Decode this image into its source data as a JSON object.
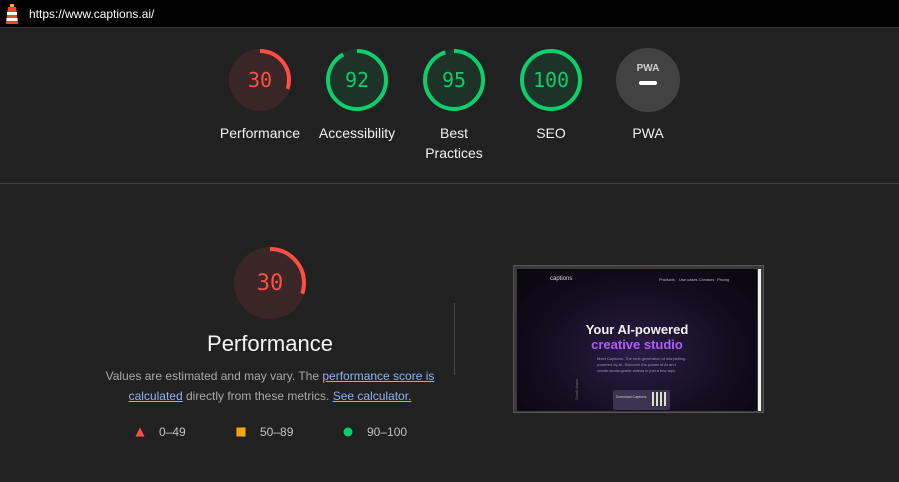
{
  "topbar": {
    "url": "https://www.captions.ai/"
  },
  "categories": [
    {
      "score": "30",
      "label": "Performance",
      "level": 0.3,
      "status": "fail"
    },
    {
      "score": "92",
      "label": "Accessibility",
      "level": 0.92,
      "status": "pass"
    },
    {
      "score": "95",
      "label_line1": "Best",
      "label_line2": "Practices",
      "level": 0.95,
      "status": "pass"
    },
    {
      "score": "100",
      "label": "SEO",
      "level": 1.0,
      "status": "pass"
    },
    {
      "label": "PWA",
      "badge_text": "PWA"
    }
  ],
  "performance": {
    "score": "30",
    "level": 0.3,
    "title": "Performance",
    "desc_prefix": "Values are estimated and may vary. The ",
    "link_score": "performance score is calculated",
    "desc_middle": " directly from these metrics. ",
    "link_calculator": "See calculator.",
    "legend": [
      {
        "range": "0–49",
        "shape": "triangle",
        "color": "#ff4e42"
      },
      {
        "range": "50–89",
        "shape": "square",
        "color": "#ffa400"
      },
      {
        "range": "90–100",
        "shape": "circle",
        "color": "#0cce6b"
      }
    ]
  },
  "screenshot": {
    "brand": "captions",
    "nav": [
      "Products",
      "Use cases",
      "Creators",
      "Pricing"
    ],
    "headline1": "Your AI-powered",
    "headline2": "creative studio",
    "subtext": "Meet Captions. The next generation of storytelling-powered by AI. Discover the power of AI and create studio-grade videos in just a few taps.",
    "card_text": "Download Captions",
    "side_label": "Scroll down"
  },
  "colors": {
    "fail": "#ff4e42",
    "fail_bg": "#3a2626",
    "pass": "#0cce6b",
    "pass_bg": "#1f3227",
    "pwa_bg": "#424242",
    "background": "#212121"
  }
}
